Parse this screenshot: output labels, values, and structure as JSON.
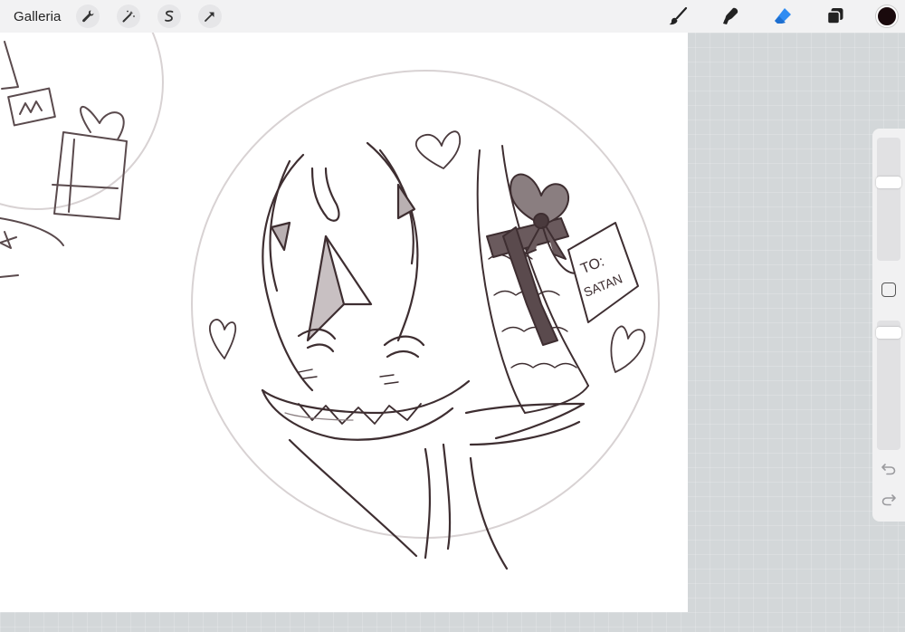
{
  "toolbar": {
    "gallery_label": "Galleria",
    "left_tools": [
      {
        "name": "wrench-icon"
      },
      {
        "name": "magic-wand-icon"
      },
      {
        "name": "selection-icon"
      },
      {
        "name": "transform-arrow-icon"
      }
    ],
    "right_tools": [
      {
        "name": "brush-icon",
        "color": "#222222"
      },
      {
        "name": "smudge-icon",
        "color": "#222222"
      },
      {
        "name": "eraser-icon",
        "color": "#2f8cf2"
      },
      {
        "name": "layers-icon",
        "color": "#222222"
      }
    ],
    "current_color": "#1a0a0d"
  },
  "canvas": {
    "tag_text_line1": "TO:",
    "tag_text_line2": "SATAN",
    "stroke_color": "#4a3a3d",
    "guide_color": "#d8d2d3"
  },
  "sidebar": {
    "size_level": 0.35,
    "opacity_level": 0.05
  }
}
